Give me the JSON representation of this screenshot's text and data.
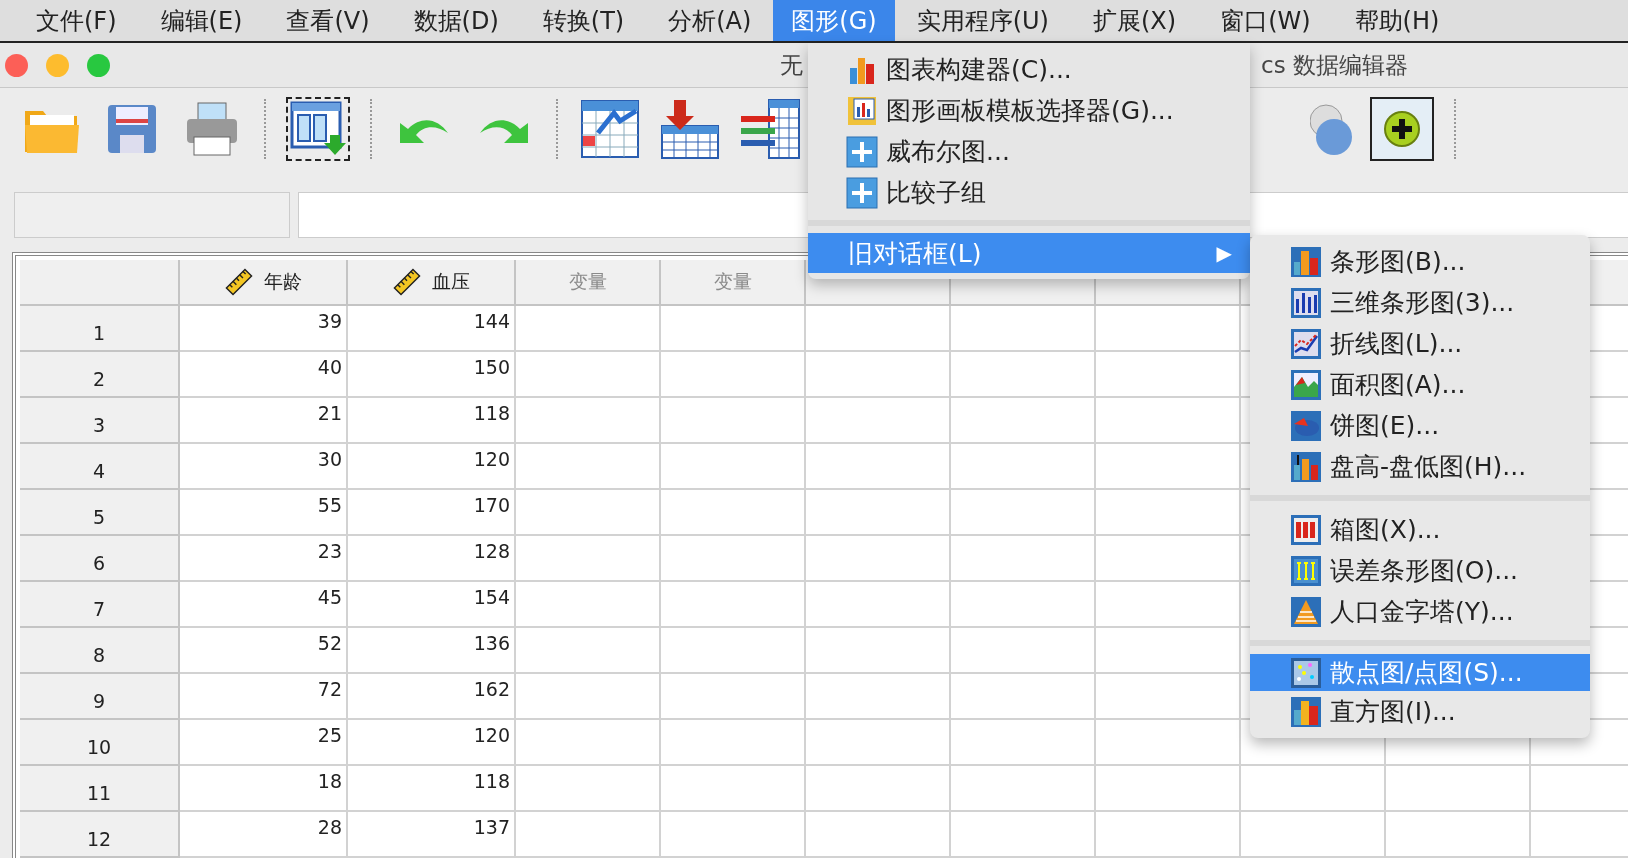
{
  "menu_bar": [
    {
      "label": "文件(F)",
      "selected": false
    },
    {
      "label": "编辑(E)",
      "selected": false
    },
    {
      "label": "查看(V)",
      "selected": false
    },
    {
      "label": "数据(D)",
      "selected": false
    },
    {
      "label": "转换(T)",
      "selected": false
    },
    {
      "label": "分析(A)",
      "selected": false
    },
    {
      "label": "图形(G)",
      "selected": true
    },
    {
      "label": "实用程序(U)",
      "selected": false
    },
    {
      "label": "扩展(X)",
      "selected": false
    },
    {
      "label": "窗口(W)",
      "selected": false
    },
    {
      "label": "帮助(H)",
      "selected": false
    }
  ],
  "window": {
    "title_left": "无",
    "title_right": "cs 数据编辑器"
  },
  "table": {
    "columns": [
      {
        "label": "年龄",
        "kind": "scale"
      },
      {
        "label": "血压",
        "kind": "scale"
      },
      {
        "label": "变量",
        "kind": "empty"
      },
      {
        "label": "变量",
        "kind": "empty"
      }
    ],
    "rows": [
      {
        "number": "1",
        "cells": [
          "39",
          "144"
        ]
      },
      {
        "number": "2",
        "cells": [
          "40",
          "150"
        ]
      },
      {
        "number": "3",
        "cells": [
          "21",
          "118"
        ]
      },
      {
        "number": "4",
        "cells": [
          "30",
          "120"
        ]
      },
      {
        "number": "5",
        "cells": [
          "55",
          "170"
        ]
      },
      {
        "number": "6",
        "cells": [
          "23",
          "128"
        ]
      },
      {
        "number": "7",
        "cells": [
          "45",
          "154"
        ]
      },
      {
        "number": "8",
        "cells": [
          "52",
          "136"
        ]
      },
      {
        "number": "9",
        "cells": [
          "72",
          "162"
        ]
      },
      {
        "number": "10",
        "cells": [
          "25",
          "120"
        ]
      },
      {
        "number": "11",
        "cells": [
          "18",
          "118"
        ]
      },
      {
        "number": "12",
        "cells": [
          "28",
          "137"
        ]
      }
    ]
  },
  "graphs_menu": [
    {
      "kind": "item",
      "label": "图表构建器(C)...",
      "selected": false
    },
    {
      "kind": "item",
      "label": "图形画板模板选择器(G)...",
      "selected": false
    },
    {
      "kind": "item",
      "label": "威布尔图...",
      "selected": false
    },
    {
      "kind": "item",
      "label": "比较子组",
      "selected": false
    },
    {
      "kind": "separator"
    },
    {
      "kind": "submenu",
      "label": "旧对话框(L)",
      "arrow": "▶",
      "selected": true
    }
  ],
  "legacy_submenu": [
    {
      "kind": "item",
      "label": "条形图(B)...",
      "selected": false
    },
    {
      "kind": "item",
      "label": "三维条形图(3)...",
      "selected": false
    },
    {
      "kind": "item",
      "label": "折线图(L)...",
      "selected": false
    },
    {
      "kind": "item",
      "label": "面积图(A)...",
      "selected": false
    },
    {
      "kind": "item",
      "label": "饼图(E)...",
      "selected": false
    },
    {
      "kind": "item",
      "label": "盘高-盘低图(H)...",
      "selected": false
    },
    {
      "kind": "separator"
    },
    {
      "kind": "item",
      "label": "箱图(X)...",
      "selected": false
    },
    {
      "kind": "item",
      "label": "误差条形图(O)...",
      "selected": false
    },
    {
      "kind": "item",
      "label": "人口金字塔(Y)...",
      "selected": false
    },
    {
      "kind": "separator"
    },
    {
      "kind": "item",
      "label": "散点图/点图(S)...",
      "selected": true
    },
    {
      "kind": "item",
      "label": "直方图(I)...",
      "selected": false
    }
  ]
}
